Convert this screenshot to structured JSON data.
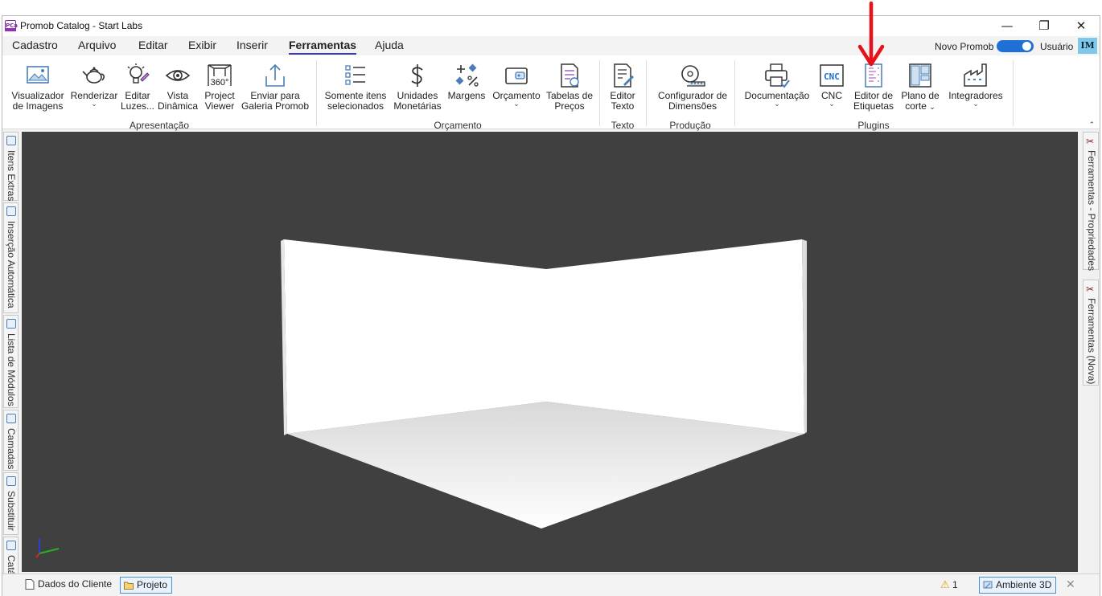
{
  "window": {
    "title": "Promob Catalog - Start Labs",
    "logo_text": "PCa"
  },
  "titlebar": {
    "minimize": "—",
    "maximize": "❐",
    "close": "✕"
  },
  "menu": {
    "items": [
      "Cadastro",
      "Arquivo",
      "Editar",
      "Exibir",
      "Inserir",
      "Ferramentas",
      "Ajuda"
    ],
    "active": "Ferramentas",
    "novo_promob_label": "Novo Promob",
    "novo_promob_on": true,
    "user_label": "Usuário",
    "avatar_initials": "IM"
  },
  "ribbon": {
    "groups": {
      "apresentacao": "Apresentação",
      "orcamento": "Orçamento",
      "texto": "Texto",
      "producao": "Produção",
      "plugins": "Plugins"
    },
    "buttons": {
      "visualizador": [
        "Visualizador",
        "de Imagens"
      ],
      "renderizar": [
        "Renderizar"
      ],
      "editar_luzes": [
        "Editar",
        "Luzes..."
      ],
      "vista_dinamica": [
        "Vista",
        "Dinâmica"
      ],
      "project_viewer": [
        "Project",
        "Viewer"
      ],
      "enviar_galeria": [
        "Enviar para",
        "Galeria Promob"
      ],
      "somente_itens": [
        "Somente itens",
        "selecionados"
      ],
      "unidades": [
        "Unidades",
        "Monetárias"
      ],
      "margens": [
        "Margens"
      ],
      "orcamento": [
        "Orçamento"
      ],
      "tabelas": [
        "Tabelas de",
        "Preços"
      ],
      "editor_texto": [
        "Editor",
        "Texto"
      ],
      "configurador": [
        "Configurador de",
        "Dimensões"
      ],
      "documentacao": [
        "Documentação"
      ],
      "cnc": [
        "CNC"
      ],
      "editor_etiquetas": [
        "Editor de",
        "Etiquetas"
      ],
      "plano_corte": [
        "Plano de",
        "corte"
      ],
      "integradores": [
        "Integradores"
      ]
    },
    "icon_texts": {
      "viewer_360": "360°",
      "cnc_badge": "CNC"
    },
    "dropdown_glyph": "⌄",
    "collapse_glyph": "⌃"
  },
  "left_panels": [
    "Itens Extras",
    "Inserção Automática",
    "Lista de Módulos",
    "Camadas",
    "Substituir",
    "Catálogo"
  ],
  "right_panels": [
    "Ferramentas - Propriedades",
    "Ferramentas (Nova)"
  ],
  "statusbar": {
    "tabs": [
      "Dados do Cliente",
      "Projeto"
    ],
    "active_tab": "Projeto",
    "warning_count": "1",
    "view_label": "Ambiente 3D",
    "close_glyph": "✕"
  },
  "colors": {
    "accent": "#1e6fd6",
    "viewport_bg": "#404040",
    "annotation_arrow": "#e8111a",
    "brand": "#9b2cc0"
  },
  "annotation": {
    "type": "red-arrow",
    "target": "editor_etiquetas"
  }
}
